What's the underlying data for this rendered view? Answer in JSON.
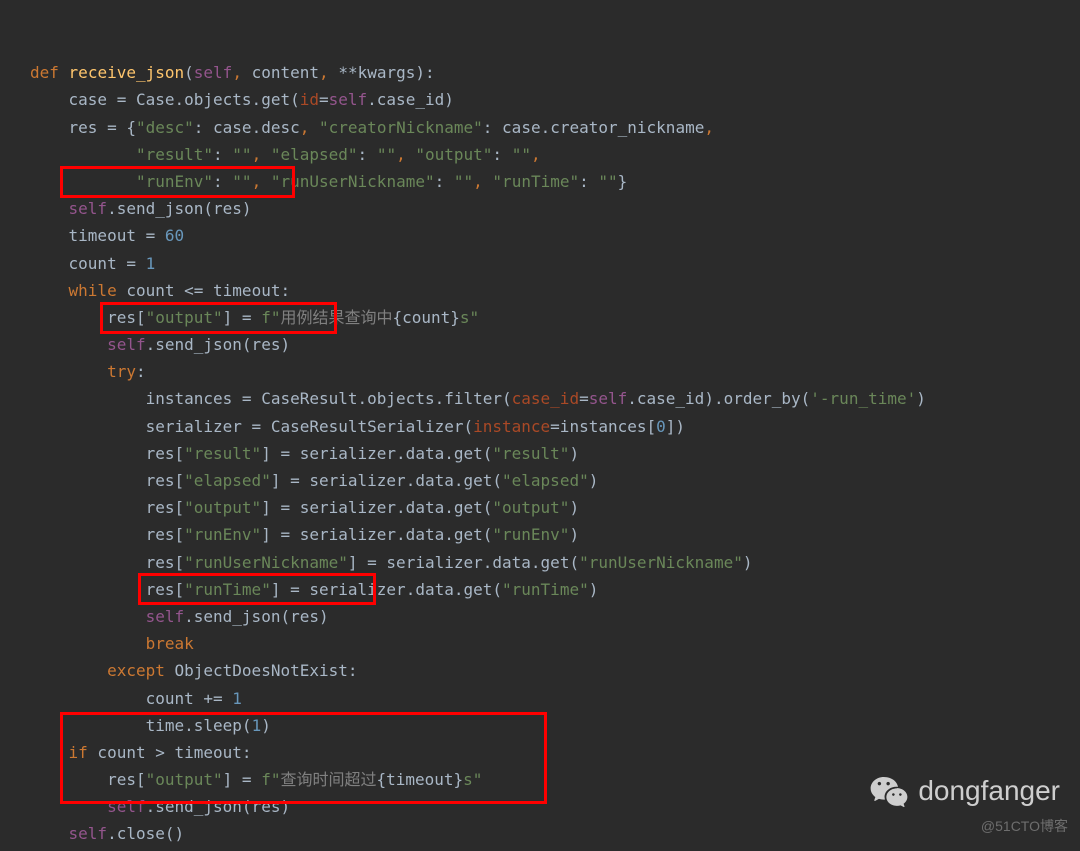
{
  "code": {
    "def": "def",
    "fn_name": "receive_json",
    "params_open": "(",
    "self": "self",
    "p_content": "content",
    "p_kwargs": "**kwargs",
    "params_close": "):",
    "l2a": "case = Case.objects.get(",
    "l2b": "id",
    "l2c": "=",
    "l2d": ".case_id)",
    "l3a": "res = {",
    "l3_desc_k": "\"desc\"",
    "l3_desc_v": ": case.desc",
    "l3_cn_k": "\"creatorNickname\"",
    "l3_cn_v": ": case.creator_nickname",
    "l4_result_k": "\"result\"",
    "l4_empty": "\"\"",
    "l4_elapsed_k": "\"elapsed\"",
    "l4_output_k": "\"output\"",
    "l5_runEnv_k": "\"runEnv\"",
    "l5_run_k": "\"runUserNickname\"",
    "l5_rt_k": "\"runTime\"",
    "l6_send": ".send_json(res)",
    "l7": "timeout = ",
    "l7n": "60",
    "l8": "count = ",
    "l8n": "1",
    "l9_while": "while",
    "l9_rest": " count <= timeout:",
    "l10a": "res[",
    "l10b": "\"output\"",
    "l10c": "] = ",
    "l10_f": "f\"",
    "l10_cn": "用例结果查询中",
    "l10_br": "{count}",
    "l10_s": "s\"",
    "l12_try": "try",
    "l13a": "instances = CaseResult.objects.filter(",
    "l13b": "case_id",
    "l13c": "=",
    "l13d": ".case_id).order_by(",
    "l13e": "'-run_time'",
    "l13f": ")",
    "l14a": "serializer = CaseResultSerializer(",
    "l14b": "instance",
    "l14c": "=instances[",
    "l14n": "0",
    "l14d": "])",
    "l15a": "res[",
    "l15k": "\"result\"",
    "l15b": "] = serializer.data.get(",
    "l15v": "\"result\"",
    "l15c": ")",
    "l16k": "\"elapsed\"",
    "l17k": "\"output\"",
    "l18k": "\"runEnv\"",
    "l19k": "\"runUserNickname\"",
    "l20k": "\"runTime\"",
    "l22_break": "break",
    "l23_except": "except",
    "l23_exc": " ObjectDoesNotExist:",
    "l24": "count += ",
    "l24n": "1",
    "l25a": "time.sleep(",
    "l25n": "1",
    "l25b": ")",
    "l26_if": "if",
    "l26_rest": " count > timeout:",
    "l27_cn": "查询时间超过",
    "l27_br": "{timeout}",
    "l29_close": ".close()"
  },
  "watermark": {
    "main": "dongfanger",
    "sub": "@51CTO博客"
  }
}
